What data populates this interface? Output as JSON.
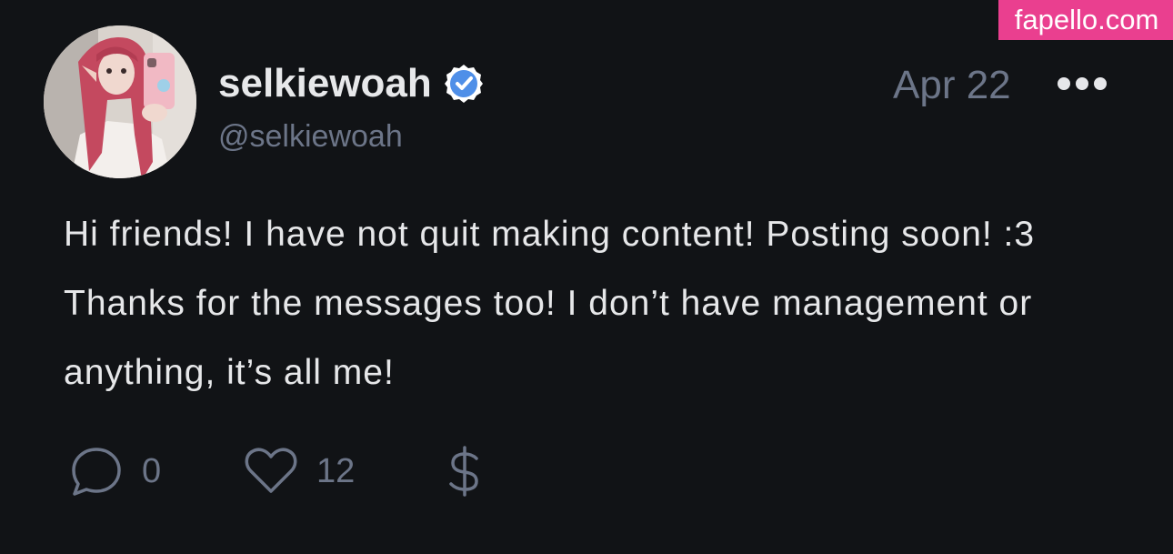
{
  "watermark": {
    "text": "fapello.com"
  },
  "post": {
    "author": {
      "display_name": "selkiewoah",
      "handle": "@selkiewoah",
      "verified": true
    },
    "date": "Apr 22",
    "text": "Hi friends! I have not quit making content! Posting soon! :3\nThanks for the messages too! I don’t have management or\nanything, it’s all me!",
    "actions": {
      "comment": {
        "icon": "comment-icon",
        "count": "0"
      },
      "like": {
        "icon": "heart-icon",
        "count": "12"
      },
      "tip": {
        "icon": "dollar-icon"
      }
    },
    "menu_icon": "more-options-icon"
  },
  "colors": {
    "background": "#111316",
    "text_primary": "#e7e8ea",
    "text_muted": "#6c7588",
    "verified_badge": "#4f8fe8",
    "watermark_bg": "#ea3f8f"
  }
}
